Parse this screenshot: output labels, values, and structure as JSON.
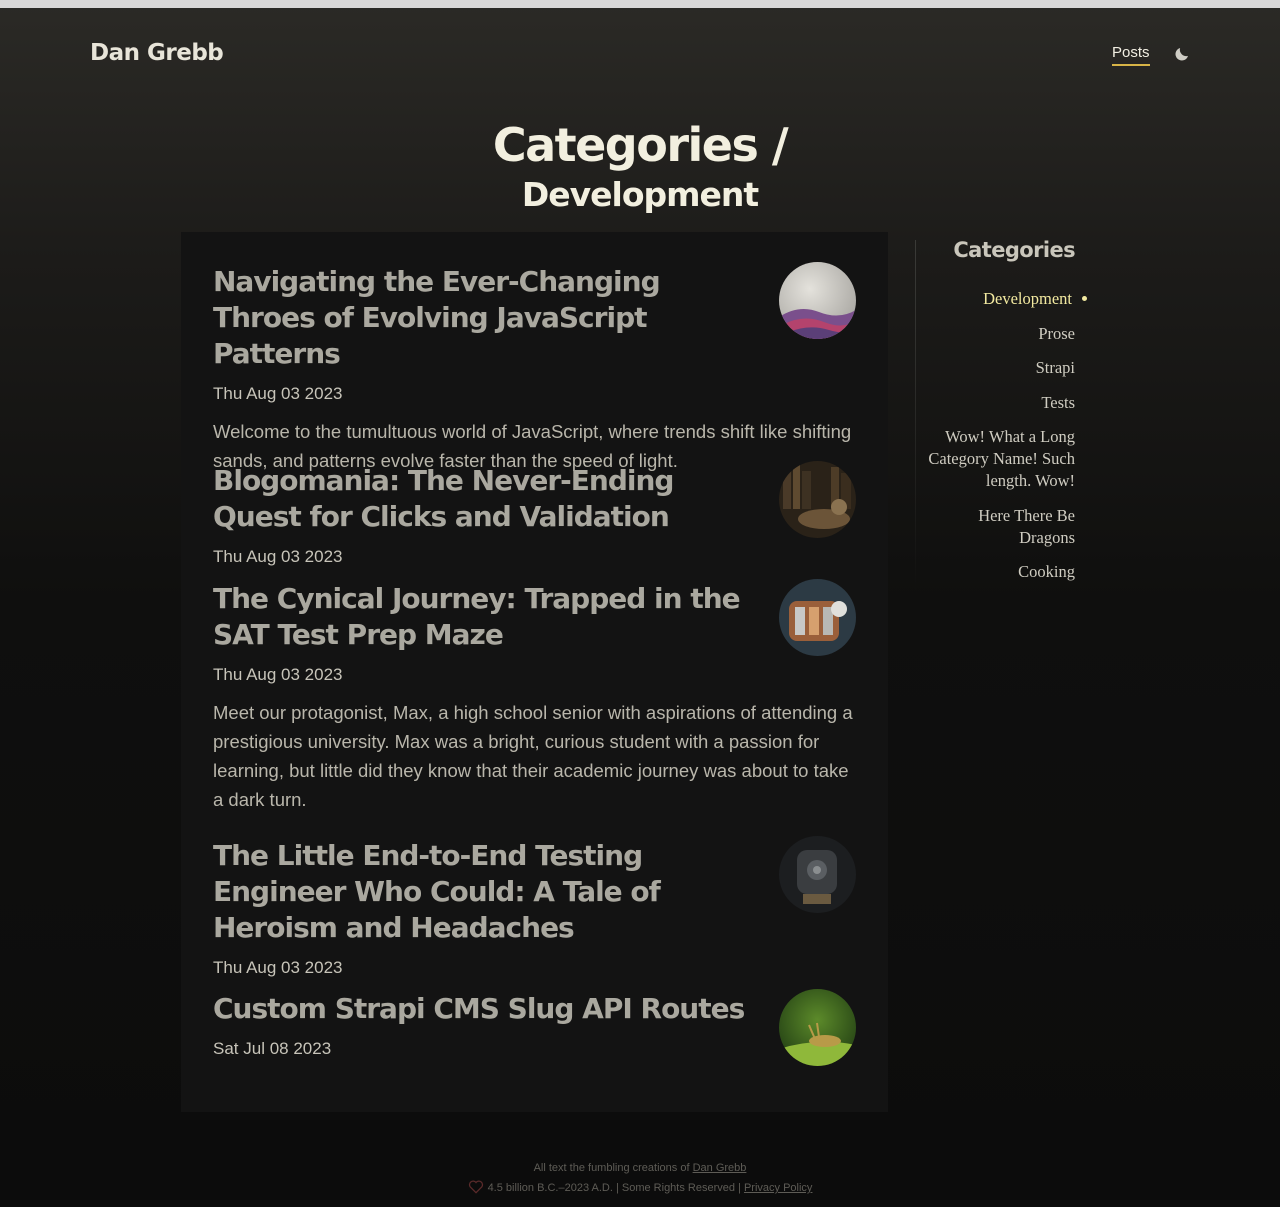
{
  "header": {
    "brand": "Dan Grebb",
    "nav_posts": "Posts"
  },
  "page": {
    "title": "Categories /",
    "subtitle": "Development"
  },
  "posts": [
    {
      "title": "Navigating the Ever-Changing Throes of Evolving JavaScript Patterns",
      "date": "Thu Aug 03 2023",
      "excerpt": "Welcome to the tumultuous world of JavaScript, where trends shift like shifting sands, and patterns evolve faster than the speed of light."
    },
    {
      "title": "Blogomania: The Never-Ending Quest for Clicks and Validation",
      "date": "Thu Aug 03 2023"
    },
    {
      "title": "The Cynical Journey: Trapped in the SAT Test Prep Maze",
      "date": "Thu Aug 03 2023",
      "excerpt": "Meet our protagonist, Max, a high school senior with aspirations of attending a prestigious university. Max was a bright, curious student with a passion for learning, but little did they know that their academic journey was about to take a dark turn."
    },
    {
      "title": "The Little End-to-End Testing Engineer Who Could: A Tale of Heroism and Headaches",
      "date": "Thu Aug 03 2023"
    },
    {
      "title": "Custom Strapi CMS Slug API Routes",
      "date": "Sat Jul 08 2023"
    }
  ],
  "sidebar": {
    "title": "Categories",
    "categories": [
      "Development",
      "Prose",
      "Strapi",
      "Tests",
      "Wow! What a Long Category Name! Such length. Wow!",
      "Here There Be Dragons",
      "Cooking"
    ]
  },
  "footer": {
    "line1_prefix": "All text the fumbling creations of",
    "line1_link": "Dan Grebb",
    "line2_text": "4.5 billion B.C.–2023 A.D. | Some Rights Reserved |",
    "line2_link": "Privacy Policy"
  },
  "colors": {
    "accent": "#d8b447",
    "active_category": "#f2e9a0"
  }
}
